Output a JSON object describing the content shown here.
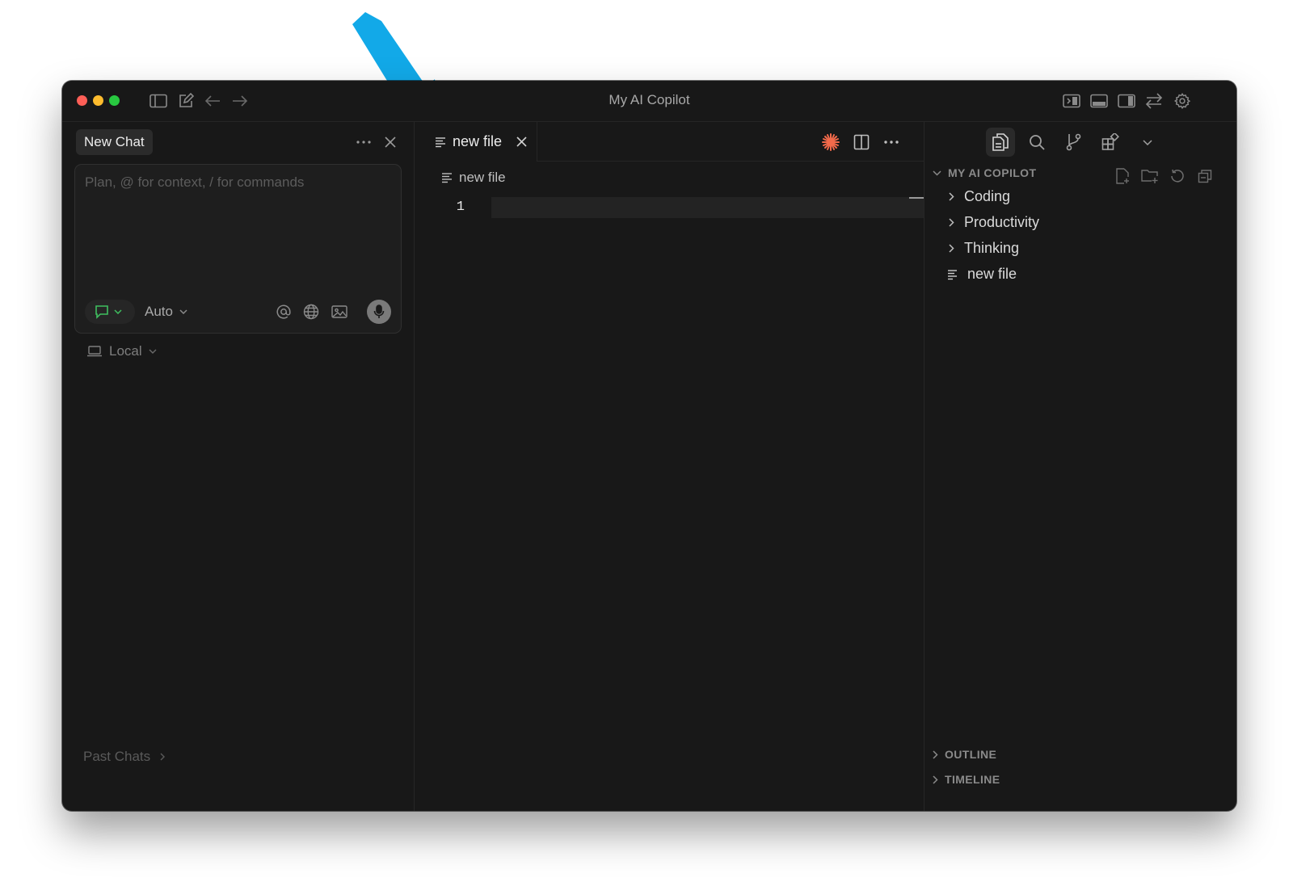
{
  "window": {
    "title": "My AI Copilot",
    "titlebar_left_icons": [
      "sidebar-toggle-icon",
      "compose-icon",
      "arrow-left-icon",
      "arrow-right-icon"
    ],
    "titlebar_right_icons": [
      "panel-left-icon",
      "panel-bottom-icon",
      "panel-right-icon",
      "swap-icon",
      "gear-icon"
    ]
  },
  "annotation": {
    "arrow_color": "#12a9e8"
  },
  "chat": {
    "tab_label": "New Chat",
    "input_placeholder": "Plan, @ for context, / for commands",
    "input_value": "",
    "mode_icon": "chat-bubble-icon",
    "model_label": "Auto",
    "composer_icons": [
      "at-icon",
      "globe-icon",
      "image-icon",
      "microphone-icon"
    ],
    "environment_label": "Local",
    "past_chats_label": "Past Chats"
  },
  "editor": {
    "tab_label": "new file",
    "breadcrumb_label": "new file",
    "line_numbers": [
      "1"
    ],
    "action_icons": [
      "sparkle-icon",
      "split-editor-icon",
      "more-icon"
    ],
    "accent": "#f26a4b"
  },
  "explorer": {
    "activity_icons": [
      "files-icon",
      "search-icon",
      "source-control-icon",
      "extensions-icon",
      "chevron-down-icon"
    ],
    "section_title": "MY AI COPILOT",
    "section_actions": [
      "new-file-icon",
      "new-folder-icon",
      "refresh-icon",
      "collapse-all-icon"
    ],
    "items": [
      {
        "label": "Coding",
        "type": "folder"
      },
      {
        "label": "Productivity",
        "type": "folder"
      },
      {
        "label": "Thinking",
        "type": "folder"
      },
      {
        "label": "new file",
        "type": "file"
      }
    ],
    "outline_label": "OUTLINE",
    "timeline_label": "TIMELINE"
  }
}
